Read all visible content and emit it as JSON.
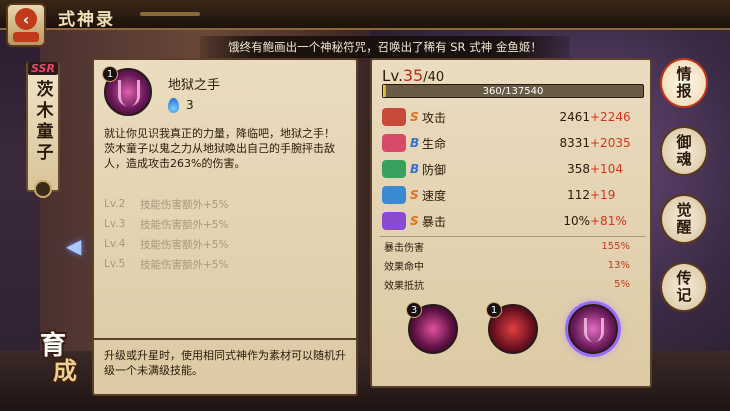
{
  "header": {
    "title": "式神录"
  },
  "notice": "饿终有鲍画出一个神秘符咒，召唤出了稀有 SR 式神 金鱼姬！",
  "shikigami": {
    "rarity": "SSR",
    "name": "茨木童子"
  },
  "growth_label_1": "育",
  "growth_label_2": "成",
  "skill": {
    "level": "1",
    "name": "地狱之手",
    "cost": "3",
    "desc": "就让你见识我真正的力量，降临吧，地狱之手！\n茨木童子以鬼之力从地狱唤出自己的手腕抨击敌人，造成攻击263%的伤害。",
    "upgrades": [
      {
        "lv": "Lv.2",
        "text": "技能伤害额外+5%"
      },
      {
        "lv": "Lv.3",
        "text": "技能伤害额外+5%"
      },
      {
        "lv": "Lv.4",
        "text": "技能伤害额外+5%"
      },
      {
        "lv": "Lv.5",
        "text": "技能伤害额外+5%"
      }
    ],
    "footer": "升级或升星时，使用相同式神作为素材可以随机升级一个未满级技能。"
  },
  "stats": {
    "lv_prefix": "Lv.",
    "level": "35",
    "max_level": "/40",
    "exp": "360/137540",
    "exp_fraction": 0.0026,
    "rows": [
      {
        "grade": "S",
        "name": "攻击",
        "base": "2461",
        "bonus": "+2246",
        "color": "#c84a3a"
      },
      {
        "grade": "B",
        "name": "生命",
        "base": "8331",
        "bonus": "+2035",
        "color": "#d84a6a"
      },
      {
        "grade": "B",
        "name": "防御",
        "base": "358",
        "bonus": "+104",
        "color": "#3aa060"
      },
      {
        "grade": "S",
        "name": "速度",
        "base": "112",
        "bonus": "+19",
        "color": "#3a8ad0"
      },
      {
        "grade": "S",
        "name": "暴击",
        "base": "10%",
        "bonus": "+81%",
        "color": "#8a4ad0"
      }
    ],
    "sub": [
      {
        "name": "暴击伤害",
        "value": "155%"
      },
      {
        "name": "效果命中",
        "value": "13%"
      },
      {
        "name": "效果抵抗",
        "value": "5%"
      }
    ]
  },
  "souls": [
    {
      "level": "3"
    },
    {
      "level": "1"
    },
    {
      "level": ""
    }
  ],
  "tabs": [
    "情报",
    "御魂",
    "觉醒",
    "传记"
  ]
}
